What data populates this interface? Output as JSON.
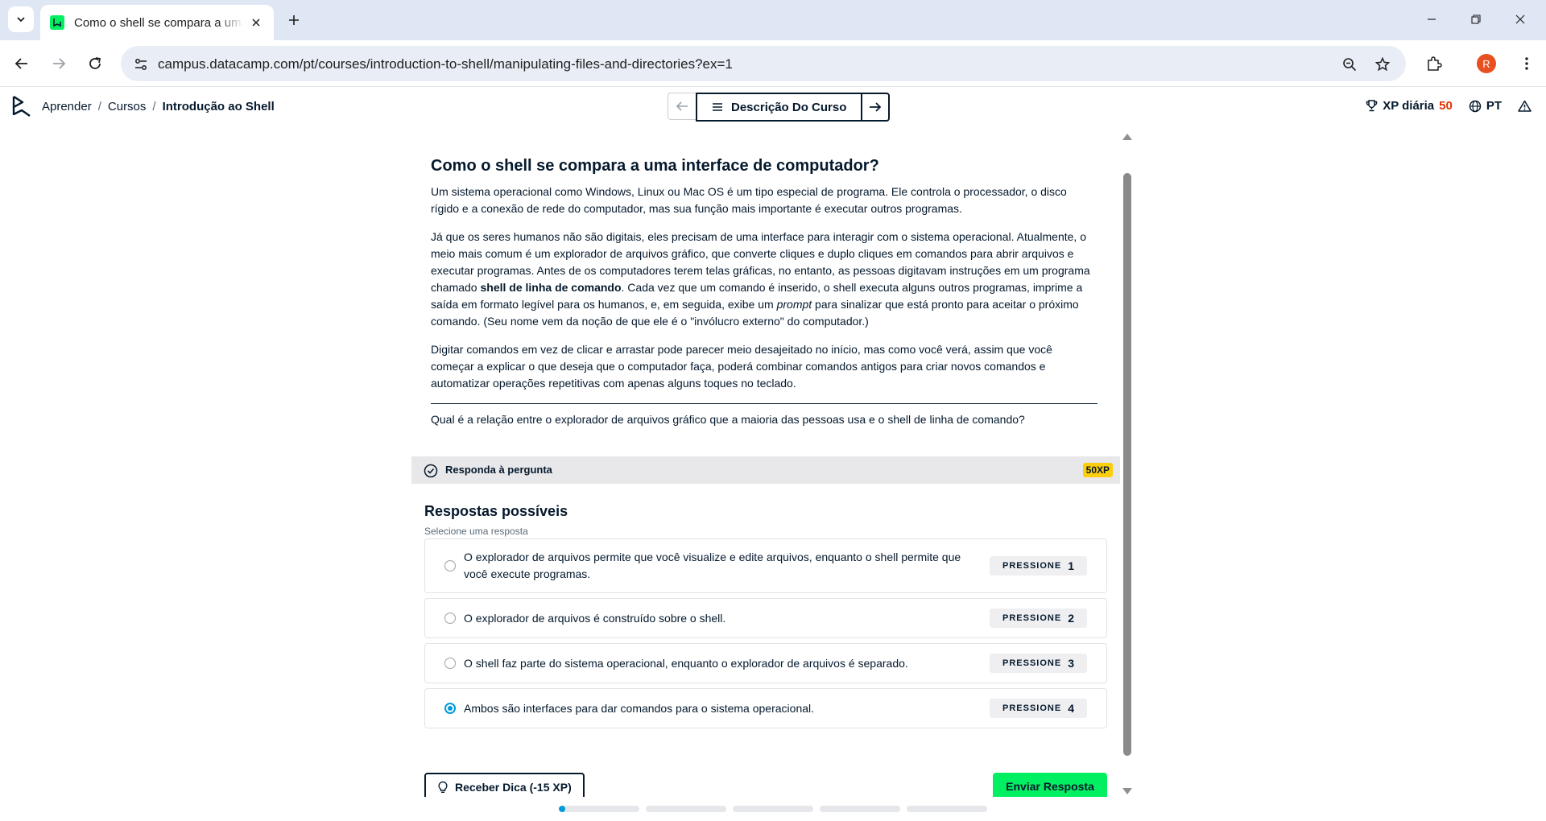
{
  "browser": {
    "tab_title": "Como o shell se compara a uma interface de computador?",
    "url": "campus.datacamp.com/pt/courses/introduction-to-shell/manipulating-files-and-directories?ex=1",
    "profile_initial": "R"
  },
  "header": {
    "breadcrumb": [
      "Aprender",
      "Cursos",
      "Introdução ao Shell"
    ],
    "course_description": "Descrição Do Curso",
    "daily_xp_label": "XP diária",
    "daily_xp_value": "50",
    "language": "PT"
  },
  "exercise": {
    "title": "Como o shell se compara a uma interface de computador?",
    "p1": "Um sistema operacional como Windows, Linux ou Mac OS é um tipo especial de programa. Ele controla o processador, o disco rígido e a conexão de rede do computador, mas sua função mais importante é executar outros programas.",
    "p2_a": "Já que os seres humanos não são digitais, eles precisam de uma interface para interagir com o sistema operacional. Atualmente, o meio mais comum é um explorador de arquivos gráfico, que converte cliques e duplo cliques em comandos para abrir arquivos e executar programas. Antes de os computadores terem telas gráficas, no entanto, as pessoas digitavam instruções em um programa chamado ",
    "p2_bold": "shell de linha de comando",
    "p2_b": ". Cada vez que um comando é inserido, o shell executa alguns outros programas, imprime a saída em formato legível para os humanos, e, em seguida, exibe um ",
    "p2_italic": "prompt",
    "p2_c": " para sinalizar que está pronto para aceitar o próximo comando. (Seu nome vem da noção de que ele é o \"invólucro externo\" do computador.)",
    "p3": "Digitar comandos em vez de clicar e arrastar pode parecer meio desajeitado no início, mas como você verá, assim que você começar a explicar o que deseja que o computador faça, poderá combinar comandos antigos para criar novos comandos e automatizar operações repetitivas com apenas alguns toques no teclado.",
    "question": "Qual é a relação entre o explorador de arquivos gráfico que a maioria das pessoas usa e o shell de linha de comando?",
    "answer_bar_label": "Responda à pergunta",
    "xp_badge": "50XP"
  },
  "answers": {
    "heading": "Respostas possíveis",
    "hint": "Selecione uma resposta",
    "options": [
      {
        "text": "O explorador de arquivos permite que você visualize e edite arquivos, enquanto o shell permite que você execute programas.",
        "key_label": "PRESSIONE",
        "key": "1",
        "selected": false
      },
      {
        "text": "O explorador de arquivos é construído sobre o shell.",
        "key_label": "PRESSIONE",
        "key": "2",
        "selected": false
      },
      {
        "text": "O shell faz parte do sistema operacional, enquanto o explorador de arquivos é separado.",
        "key_label": "PRESSIONE",
        "key": "3",
        "selected": false
      },
      {
        "text": "Ambos são interfaces para dar comandos para o sistema operacional.",
        "key_label": "PRESSIONE",
        "key": "4",
        "selected": true
      }
    ]
  },
  "actions": {
    "hint_button": "Receber Dica (-15 XP)",
    "submit_button": "Enviar Resposta"
  },
  "progress": {
    "segments": 5,
    "current_segment_fill": 0.08
  },
  "colors": {
    "brand_green": "#03ef62",
    "navy": "#05192d",
    "xp_badge": "#fcce0d",
    "selected_radio": "#009bd8"
  }
}
